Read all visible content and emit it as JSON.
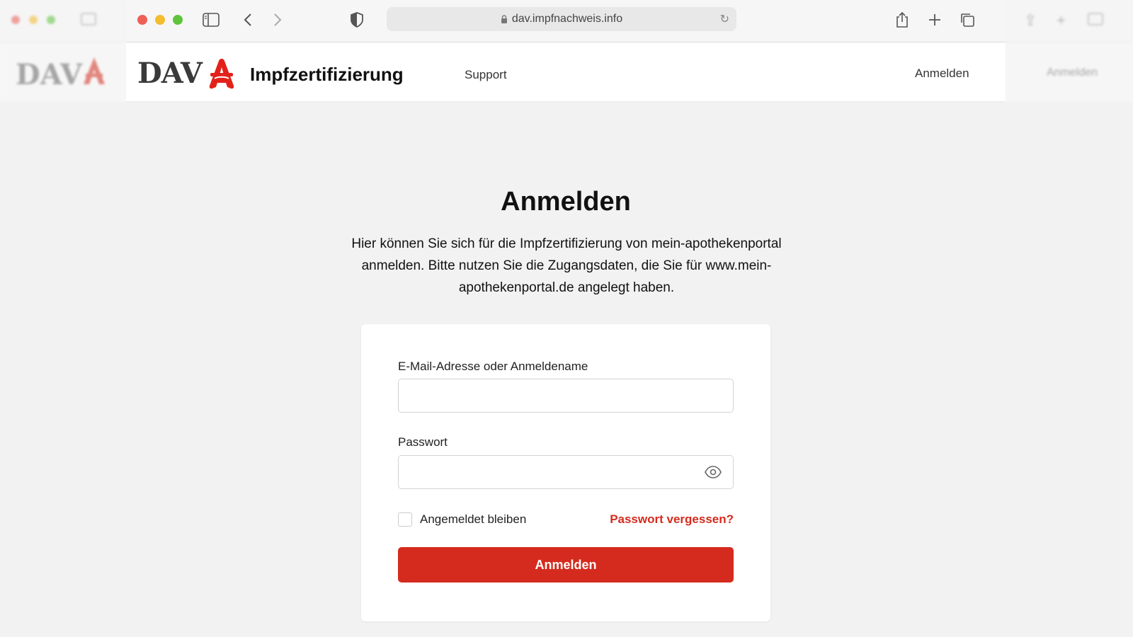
{
  "browser": {
    "url": "dav.impfnachweis.info"
  },
  "header": {
    "logo_text": "DAV",
    "app_title": "Impfzertifizierung",
    "nav_support": "Support",
    "nav_login": "Anmelden"
  },
  "side_right": {
    "login_text": "Anmelden"
  },
  "main": {
    "title": "Anmelden",
    "description": "Hier können Sie sich für die Impfzertifizierung von mein-apothekenportal anmelden. Bitte nutzen Sie die Zugangsdaten, die Sie für www.mein-apothekenportal.de angelegt haben.",
    "form": {
      "email_label": "E-Mail-Adresse oder Anmeldename",
      "email_value": "",
      "password_label": "Passwort",
      "password_value": "",
      "remember_label": "Angemeldet bleiben",
      "remember_checked": false,
      "forgot_label": "Passwort vergessen?",
      "submit_label": "Anmelden"
    }
  },
  "colors": {
    "accent": "#d52b1e",
    "background": "#f2f2f2",
    "card": "#ffffff"
  },
  "icons": [
    "lock-icon",
    "reload-icon",
    "sidebar-icon",
    "back-icon",
    "forward-icon",
    "shield-icon",
    "share-icon",
    "new-tab-icon",
    "tabs-icon",
    "eye-icon",
    "pharmacy-a-icon"
  ]
}
